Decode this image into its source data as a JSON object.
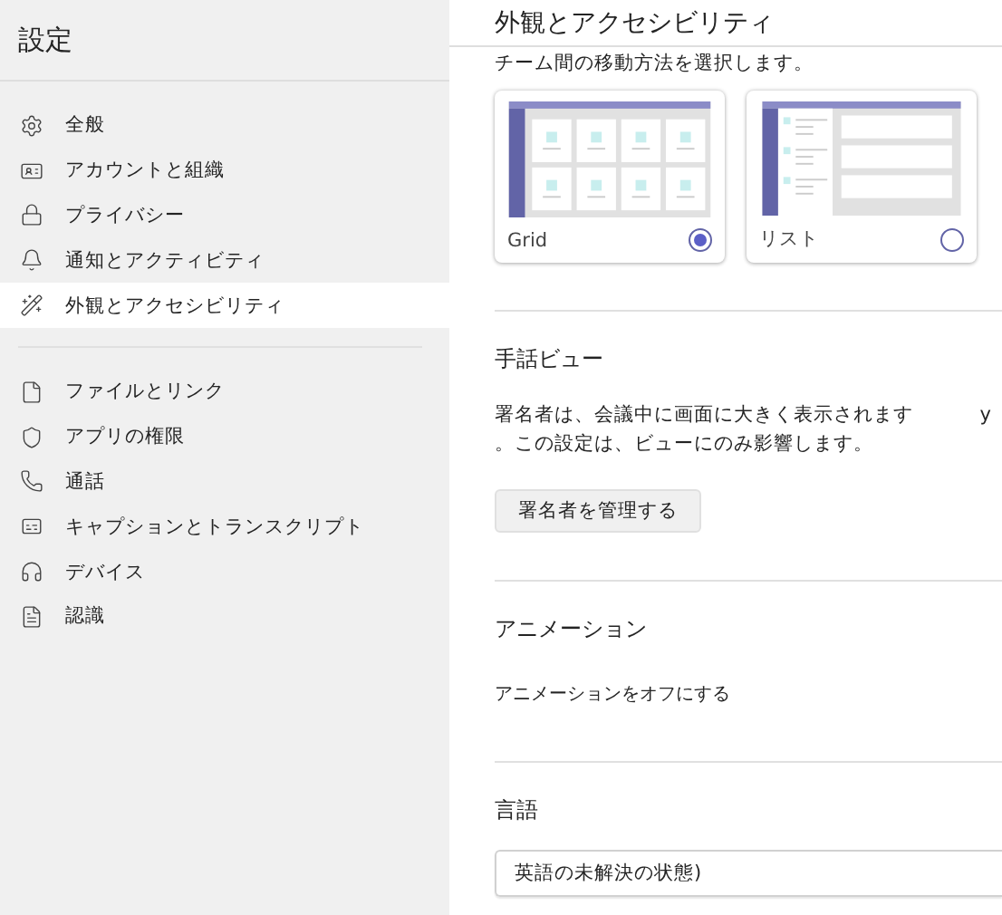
{
  "sidebar": {
    "title": "設定",
    "groups": [
      [
        {
          "label": "全般",
          "selected": false
        },
        {
          "label": "アカウントと組織",
          "selected": false
        },
        {
          "label": "プライバシー",
          "selected": false
        },
        {
          "label": "通知とアクティビティ",
          "selected": false
        },
        {
          "label": "外観とアクセシビリティ",
          "selected": true
        }
      ],
      [
        {
          "label": "ファイルとリンク",
          "selected": false
        },
        {
          "label": "アプリの権限",
          "selected": false
        },
        {
          "label": "通話",
          "selected": false
        },
        {
          "label": "キャプションとトランスクリプト",
          "selected": false
        },
        {
          "label": "デバイス",
          "selected": false
        },
        {
          "label": "認識",
          "selected": false
        }
      ]
    ]
  },
  "main": {
    "title": "外観とアクセシビリティ",
    "layout": {
      "description": "チーム間の移動方法を選択します。",
      "options": [
        {
          "kind": "grid",
          "label": "Grid",
          "selected": true
        },
        {
          "kind": "list",
          "label": "リスト",
          "selected": false
        }
      ]
    },
    "sign_language": {
      "heading": "手話ビュー",
      "lines": [
        "署名者は、会議中に画面に大きく表示されます",
        "。この設定は、ビューにのみ影響します。"
      ],
      "side_text": "y",
      "button": "署名者を管理する"
    },
    "animation": {
      "heading": "アニメーション",
      "label": "アニメーションをオフにする"
    },
    "language": {
      "heading": "言語",
      "value": "英語の未解決の状態)"
    }
  }
}
